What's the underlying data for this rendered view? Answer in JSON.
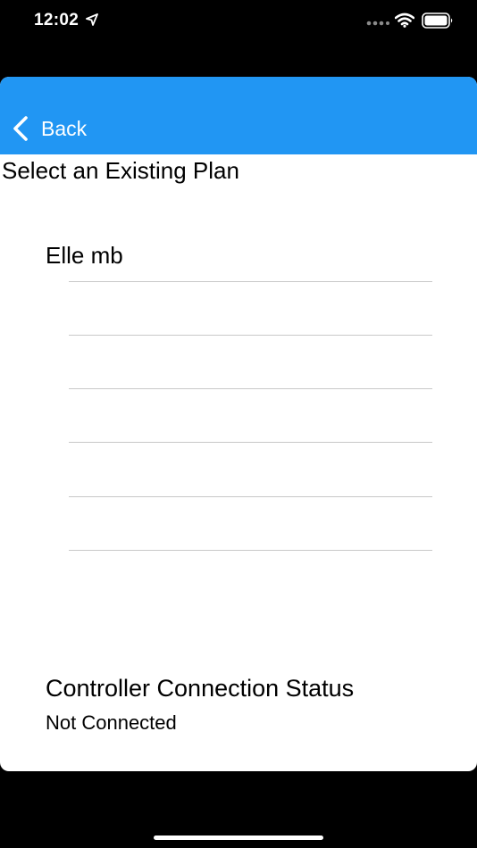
{
  "status_bar": {
    "time": "12:02",
    "icons": [
      "location-arrow-icon",
      "cellular-signal-icon",
      "wifi-icon",
      "battery-icon"
    ]
  },
  "nav": {
    "back_label": "Back",
    "back_icon": "chevron-left-icon",
    "bar_color": "#2196f3"
  },
  "page": {
    "title": "Select an Existing Plan"
  },
  "plans": {
    "items": [
      "Elle mb",
      "",
      "",
      "",
      "",
      ""
    ]
  },
  "connection": {
    "heading": "Controller Connection Status",
    "value": "Not Connected"
  }
}
